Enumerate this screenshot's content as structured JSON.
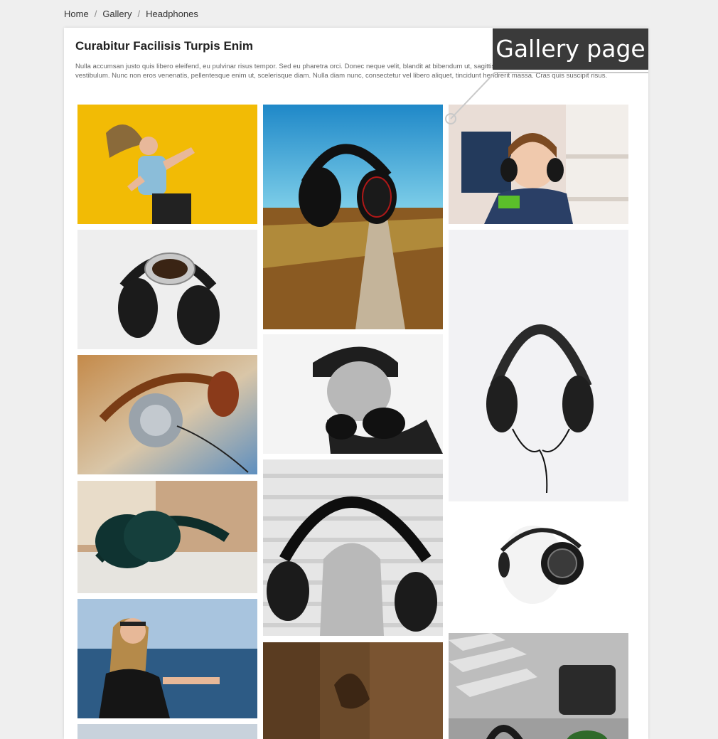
{
  "breadcrumb": {
    "items": [
      "Home",
      "Gallery",
      "Headphones"
    ],
    "separator": "/"
  },
  "page": {
    "title": "Curabitur Facilisis Turpis Enim",
    "intro": "Nulla accumsan justo quis libero eleifend, eu pulvinar risus tempor. Sed eu pharetra orci. Donec neque velit, blandit at bibendum ut, sagittis a tortor. Donec euismod non augue eu vestibulum. Nunc non eros venenatis, pellentesque enim ut, scelerisque diam. Nulla diam nunc, consectetur vel libero aliquet, tincidunt hendrerit massa. Cras quis suscipit risus."
  },
  "callout": {
    "label": "Gallery page"
  },
  "colors": {
    "background": "#efefef",
    "card": "#ffffff",
    "callout_bg": "#3a3a3a",
    "yellow": "#f2bb05",
    "sky": "#3fa6d8"
  },
  "gallery": {
    "images": [
      {
        "name": "gallery-image-woman-yellow-background"
      },
      {
        "name": "gallery-image-headphones-over-field"
      },
      {
        "name": "gallery-image-child-with-headphones"
      },
      {
        "name": "gallery-image-headphones-with-coffee"
      },
      {
        "name": "gallery-image-man-with-headphones"
      },
      {
        "name": "gallery-image-black-headphones-white"
      },
      {
        "name": "gallery-image-brown-headphones"
      },
      {
        "name": "gallery-image-headphones-on-chair"
      },
      {
        "name": "gallery-image-mannequin-headphones"
      },
      {
        "name": "gallery-image-green-headphones-on-book"
      },
      {
        "name": "gallery-image-girl-by-sea"
      },
      {
        "name": "gallery-image-wooden-surface"
      },
      {
        "name": "gallery-image-desk-with-headphones"
      },
      {
        "name": "gallery-image-bottom-partial"
      }
    ]
  }
}
